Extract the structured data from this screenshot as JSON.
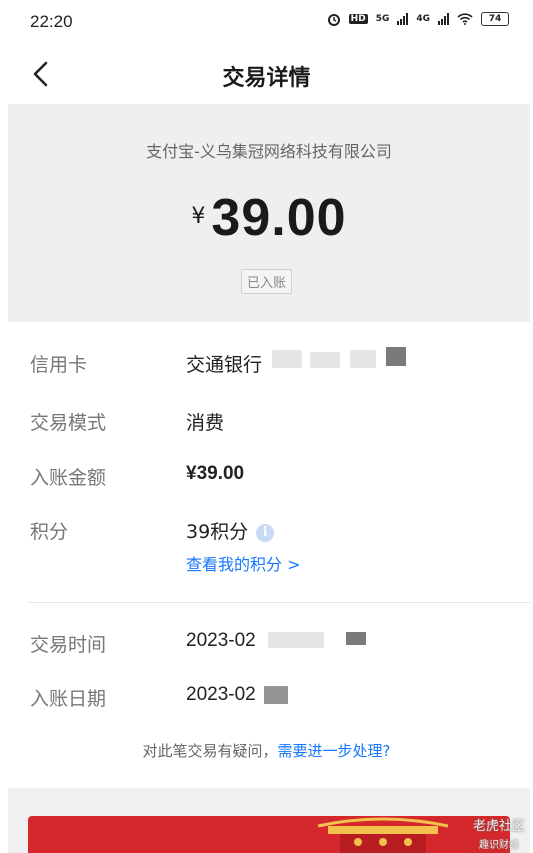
{
  "status_bar": {
    "time": "22:20",
    "hd": "HD",
    "net1": "5G",
    "net2": "4G",
    "battery": "74"
  },
  "header": {
    "title": "交易详情"
  },
  "summary": {
    "merchant": "支付宝-义乌集冠网络科技有限公司",
    "currency": "¥",
    "amount": "39.00",
    "status": "已入账"
  },
  "details": {
    "card_label": "信用卡",
    "card_value": "交通银行",
    "mode_label": "交易模式",
    "mode_value": "消费",
    "amount_label": "入账金额",
    "amount_value": "¥39.00",
    "points_label": "积分",
    "points_value": "39积分",
    "points_link": "查看我的积分 >",
    "time_label": "交易时间",
    "time_value": "2023-02",
    "date_label": "入账日期",
    "date_value": "2023-02"
  },
  "footer": {
    "question": "对此笔交易有疑问，",
    "question_link": "需要进一步处理?"
  },
  "watermark": {
    "line1": "老虎社区",
    "line2": "趣识财经"
  },
  "colors": {
    "accent": "#1677ff",
    "card_bg": "#efeff2",
    "banner": "#d4282c"
  }
}
